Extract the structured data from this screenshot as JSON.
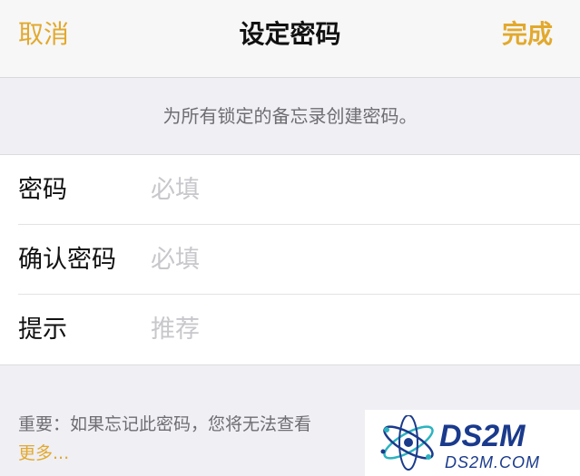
{
  "navbar": {
    "cancel_label": "取消",
    "title": "设定密码",
    "done_label": "完成"
  },
  "intro_text": "为所有锁定的备忘录创建密码。",
  "form": {
    "rows": [
      {
        "label": "密码",
        "placeholder": "必填"
      },
      {
        "label": "确认密码",
        "placeholder": "必填"
      },
      {
        "label": "提示",
        "placeholder": "推荐"
      }
    ]
  },
  "note": {
    "text": "重要：如果忘记此密码，您将无法查看",
    "more_label": "更多..."
  },
  "watermark": {
    "brand": "DS2M",
    "site": "DS2M.COM"
  },
  "colors": {
    "accent": "#e2a92e",
    "background": "#efeff4",
    "watermark_blue": "#1a3a8c",
    "watermark_cyan": "#2bb3c0"
  }
}
